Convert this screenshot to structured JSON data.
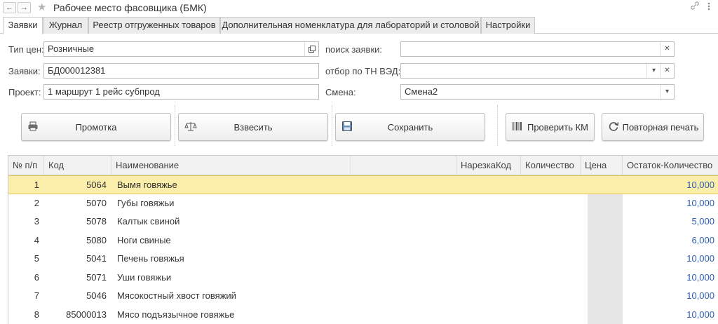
{
  "window": {
    "title": "Рабочее место фасовщика (БМК)",
    "nav_back": "←",
    "nav_forward": "→",
    "star_icon": "★",
    "link_icon": "🔗",
    "menu_icon": "⋮"
  },
  "tabs": [
    {
      "label": "Заявки"
    },
    {
      "label": "Журнал"
    },
    {
      "label": "Реестр отгруженных товаров"
    },
    {
      "label": "Дополнительная номенклатура для лабораторий и столовой"
    },
    {
      "label": "Настройки"
    }
  ],
  "form": {
    "price_type_label": "Тип цен:",
    "price_type_value": "Розничные",
    "order_label": "Заявки:",
    "order_value": "БД000012381",
    "project_label": "Проект:",
    "project_value": "1 маршрут 1 рейс субпрод",
    "search_label": "поиск заявки:",
    "search_value": "",
    "tnved_label": "отбор по ТН ВЭД:",
    "tnved_value": "",
    "shift_label": "Смена:",
    "shift_value": "Смена2"
  },
  "buttons": {
    "flush": "Промотка",
    "weigh": "Взвесить",
    "save": "Сохранить",
    "check_km": "Проверить КМ",
    "reprint": "Повторная печать"
  },
  "table": {
    "headers": {
      "num": "№ п/п",
      "code": "Код",
      "name": "Наименование",
      "cut_code": "НарезкаКод",
      "quantity": "Количество",
      "price": "Цена",
      "remaining": "Остаток-Количество"
    },
    "rows": [
      {
        "num": "1",
        "code": "5064",
        "name": "Вымя говяжье",
        "remaining": "10,000"
      },
      {
        "num": "2",
        "code": "5070",
        "name": "Губы говяжьи",
        "remaining": "10,000"
      },
      {
        "num": "3",
        "code": "5078",
        "name": "Калтык свиной",
        "remaining": "5,000"
      },
      {
        "num": "4",
        "code": "5080",
        "name": "Ноги свиные",
        "remaining": "6,000"
      },
      {
        "num": "5",
        "code": "5041",
        "name": "Печень говяжья",
        "remaining": "10,000"
      },
      {
        "num": "6",
        "code": "5071",
        "name": "Уши говяжьи",
        "remaining": "10,000"
      },
      {
        "num": "7",
        "code": "5046",
        "name": "Мясокостный хвост говяжий",
        "remaining": "10,000"
      },
      {
        "num": "8",
        "code": "85000013",
        "name": "Мясо подъязычное говяжье",
        "remaining": "10,000"
      }
    ]
  }
}
